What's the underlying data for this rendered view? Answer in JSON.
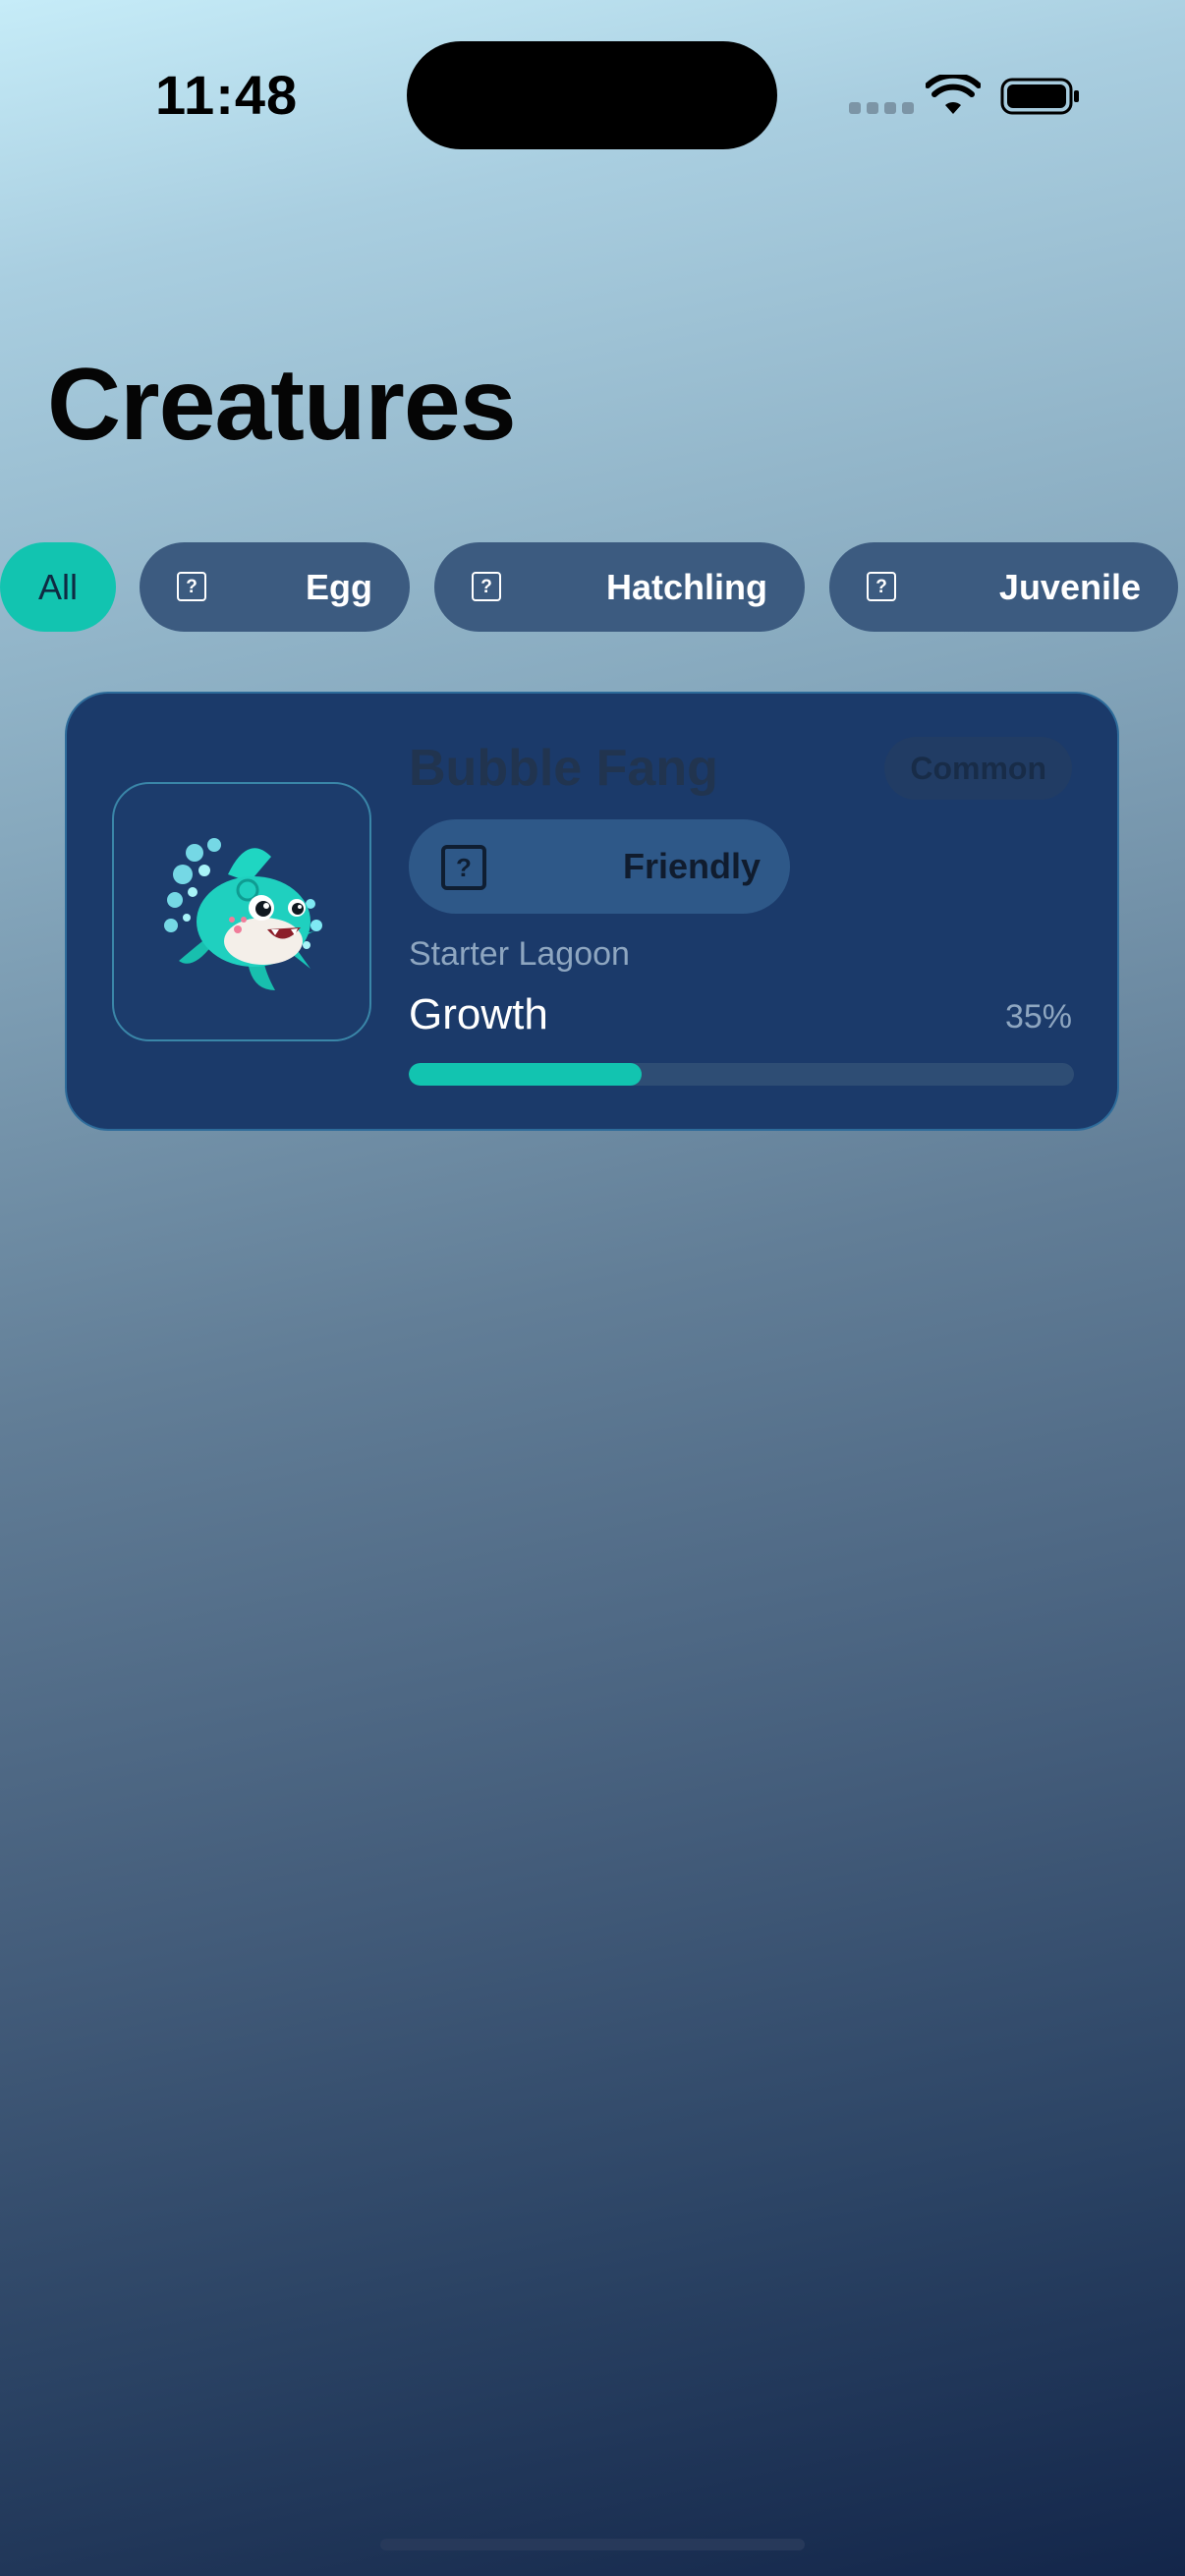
{
  "status_bar": {
    "time": "11:48"
  },
  "header": {
    "title": "Creatures"
  },
  "filters": [
    {
      "label": "All",
      "active": true,
      "icon": null
    },
    {
      "label": "Egg",
      "active": false,
      "icon": "question-mark-icon"
    },
    {
      "label": "Hatchling",
      "active": false,
      "icon": "question-mark-icon"
    },
    {
      "label": "Juvenile",
      "active": false,
      "icon": "question-mark-icon"
    }
  ],
  "creature": {
    "name": "Bubble Fang",
    "rarity": "Common",
    "temperament": "Friendly",
    "temperament_icon": "?",
    "habitat": "Starter Lagoon",
    "growth_label": "Growth",
    "growth_percent_text": "35%",
    "growth_value": 0.35,
    "image_icon": "teal-fish-creature"
  },
  "colors": {
    "accent": "#12c4b0",
    "card_bg": "#1b3a6a",
    "chip_bg": "#3c5b80"
  }
}
